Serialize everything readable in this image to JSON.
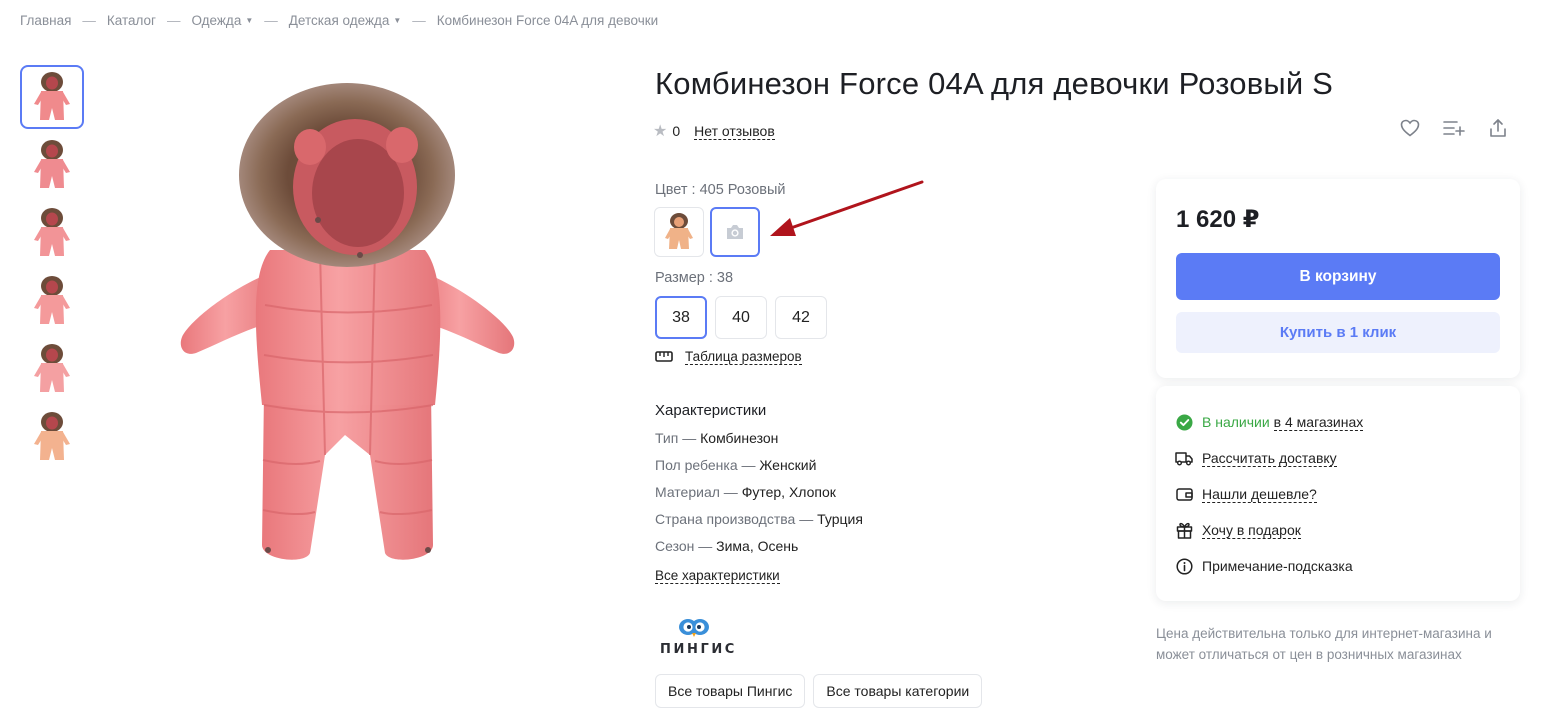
{
  "breadcrumb": {
    "items": [
      {
        "label": "Главная",
        "dropdown": false
      },
      {
        "label": "Каталог",
        "dropdown": false
      },
      {
        "label": "Одежда",
        "dropdown": true
      },
      {
        "label": "Детская одежда",
        "dropdown": true
      },
      {
        "label": "Комбинезон Force 04A для девочки",
        "dropdown": false
      }
    ],
    "separator": "—"
  },
  "gallery": {
    "thumbnail_count": 6,
    "active_index": 0,
    "thumb_colors": [
      "#f08a8c",
      "#ef8b90",
      "#f29497",
      "#f49a9b",
      "#f4a0a2",
      "#f3b28f"
    ]
  },
  "product": {
    "title": "Комбинезон Force 04A для девочки Розовый S",
    "rating": "0",
    "reviews_label": "Нет отзывов",
    "color_label": "Цвет : 405 Розовый",
    "size_label": "Размер : 38",
    "sizes": [
      "38",
      "40",
      "42"
    ],
    "selected_size": "38",
    "size_table_label": "Таблица размеров"
  },
  "specs": {
    "title": "Характеристики",
    "items": [
      {
        "key": "Тип",
        "value": "Комбинезон"
      },
      {
        "key": "Пол ребенка",
        "value": "Женский"
      },
      {
        "key": "Материал",
        "value": "Футер, Хлопок"
      },
      {
        "key": "Страна производства",
        "value": "Турция"
      },
      {
        "key": "Сезон",
        "value": "Зима, Осень"
      }
    ],
    "dash": "—",
    "all_label": "Все характеристики"
  },
  "brand": {
    "name": "ПИНГИС",
    "all_brand_label": "Все товары Пингис",
    "all_category_label": "Все товары категории"
  },
  "price_card": {
    "price": "1 620 ₽",
    "cart_label": "В корзину",
    "one_click_label": "Купить в 1 клик"
  },
  "info_card": {
    "stock_text": "В наличии",
    "stock_link": "в 4 магазинах",
    "delivery": "Рассчитать доставку",
    "cheaper": "Нашли дешевле?",
    "gift": "Хочу в подарок",
    "hint": "Примечание-подсказка"
  },
  "note": "Цена действительна только для интернет-магазина и может отличаться от цен в розничных магазинах",
  "colors": {
    "accent": "#5b7bf5",
    "accent_light": "#eef1fd",
    "stock_green": "#3aa845",
    "product_pink": "#f08a8c",
    "annotation_arrow": "#b0141c"
  },
  "icons": {
    "wishlist": "heart-icon",
    "compare": "compare-list-icon",
    "share": "share-icon",
    "size_table": "ruler-icon",
    "stock": "check-circle-icon",
    "delivery": "truck-icon",
    "cheaper": "wallet-icon",
    "gift": "gift-icon",
    "hint": "info-icon"
  }
}
